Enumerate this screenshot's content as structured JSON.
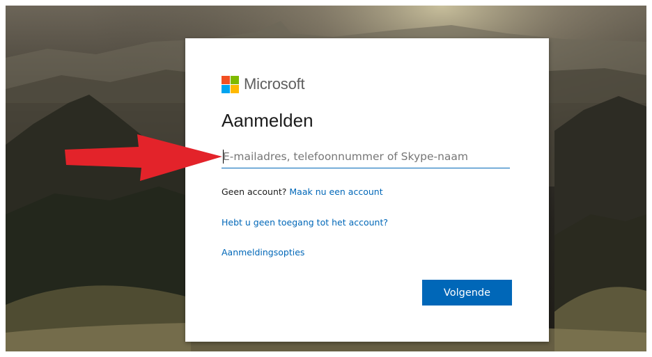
{
  "brand": {
    "name": "Microsoft",
    "logo_colors": [
      "#f25022",
      "#7fba00",
      "#00a4ef",
      "#ffb900"
    ]
  },
  "login": {
    "title": "Aanmelden",
    "email_placeholder": "E-mailadres, telefoonnummer of Skype-naam",
    "email_value": "",
    "no_account_text": "Geen account?",
    "create_account_link": "Maak nu een account",
    "no_access_link": "Hebt u geen toegang tot het account?",
    "signin_options_link": "Aanmeldingsopties",
    "next_button_label": "Volgende"
  },
  "colors": {
    "accent": "#0067b8",
    "arrow": "#e3232a"
  },
  "annotation": {
    "icon": "arrow-right-icon"
  }
}
